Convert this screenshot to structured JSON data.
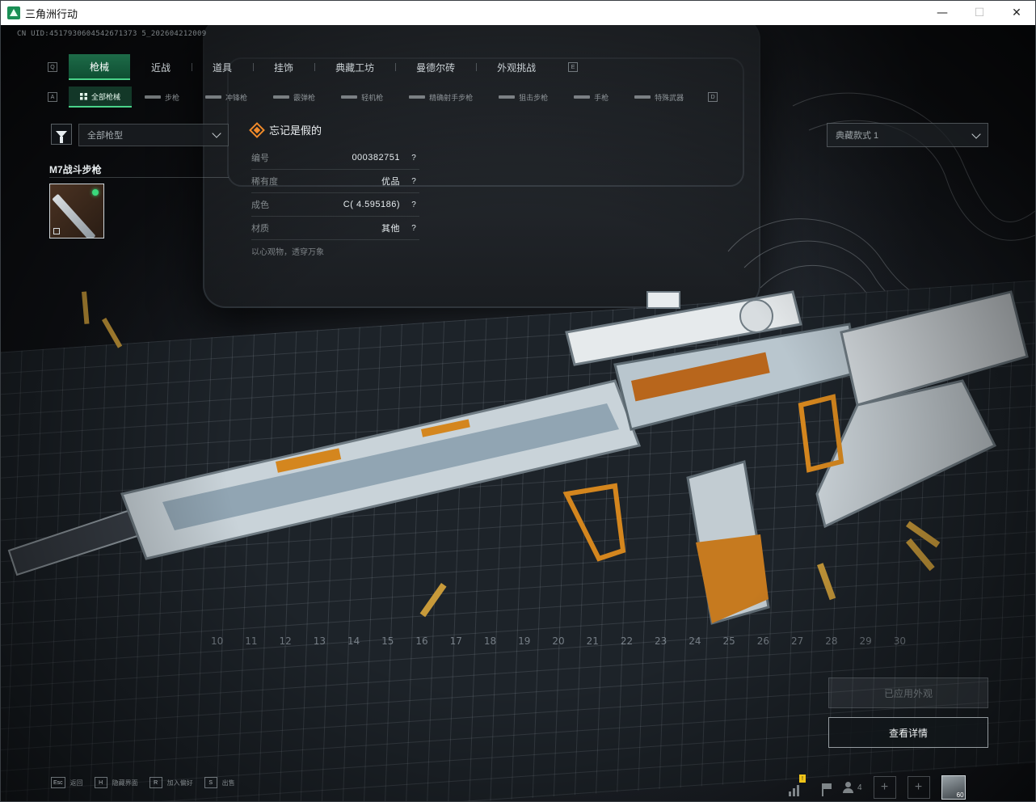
{
  "window": {
    "title": "三角洲行动",
    "controls": [
      "—",
      "☐",
      "✕"
    ]
  },
  "uid": "CN UID:4517930604542671373 5_202604212009",
  "tabs": {
    "hint_left": "Q",
    "hint_right": "E",
    "items": [
      {
        "label": "枪械",
        "active": true
      },
      {
        "label": "近战",
        "active": false
      },
      {
        "label": "道具",
        "active": false
      },
      {
        "label": "挂饰",
        "active": false
      },
      {
        "label": "典藏工坊",
        "active": false
      },
      {
        "label": "曼德尔砖",
        "active": false
      },
      {
        "label": "外观挑战",
        "active": false
      }
    ]
  },
  "subtabs": {
    "hint_left": "A",
    "hint_right": "D",
    "items": [
      {
        "label": "全部枪械",
        "active": true
      },
      {
        "label": "步枪",
        "active": false
      },
      {
        "label": "冲锋枪",
        "active": false
      },
      {
        "label": "霰弹枪",
        "active": false
      },
      {
        "label": "轻机枪",
        "active": false
      },
      {
        "label": "精确射手步枪",
        "active": false
      },
      {
        "label": "狙击步枪",
        "active": false
      },
      {
        "label": "手枪",
        "active": false
      },
      {
        "label": "特殊武器",
        "active": false
      }
    ]
  },
  "filter": {
    "weapon_type": "全部枪型",
    "icon": "filter-icon"
  },
  "weapon": {
    "name": "M7战斗步枪"
  },
  "skin": {
    "name": "忘记是假的",
    "properties": [
      {
        "label": "编号",
        "value": "000382751"
      },
      {
        "label": "稀有度",
        "value": "优品"
      },
      {
        "label": "成色",
        "value": "C( 4.595186)"
      },
      {
        "label": "材质",
        "value": "其他"
      }
    ],
    "help_glyph": "?",
    "motto": "以心观物，透穿万象"
  },
  "style_select": {
    "value": "典藏款式 1"
  },
  "mat_numbers": [
    "10",
    "11",
    "12",
    "13",
    "14",
    "15",
    "16",
    "17",
    "18",
    "19",
    "20",
    "21",
    "22",
    "23",
    "24",
    "25",
    "26",
    "27",
    "28",
    "29",
    "30"
  ],
  "actions": {
    "apply_label": "已应用外观",
    "detail_label": "查看详情"
  },
  "bottom_hints": [
    {
      "key": "Esc",
      "label": "返回"
    },
    {
      "key": "H",
      "label": "隐藏界面"
    },
    {
      "key": "R",
      "label": "加入偏好"
    },
    {
      "key": "S",
      "label": "出售"
    }
  ],
  "status": {
    "stats_badge": "!",
    "friends_count": "4",
    "plus": "+",
    "avatar_level": "60"
  },
  "colors": {
    "accent_green": "#1d6b48",
    "accent_green_bright": "#4ad38a",
    "rarity_orange": "#f08a2a",
    "weapon_orange": "#d4861e"
  }
}
